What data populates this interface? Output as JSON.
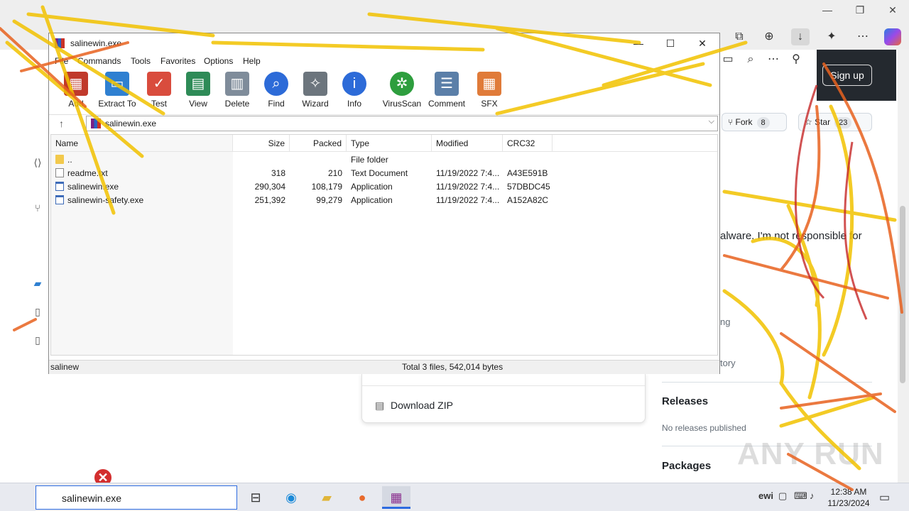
{
  "browser": {
    "signup_label": "Sign up",
    "fork_label": "Fork",
    "fork_count": "8",
    "star_label": "Star",
    "star_count": "23",
    "about_fragment": "alware. I'm not responsible for",
    "fragment_ng": "ng",
    "fragment_tory": "tory",
    "releases_heading": "Releases",
    "releases_text": "No releases published",
    "packages_heading": "Packages",
    "download_zip_label": "Download ZIP",
    "watermark": "ANY RUN"
  },
  "winrar": {
    "title": "salinewin.exe",
    "menu": [
      "File",
      "Commands",
      "Tools",
      "Favorites",
      "Options",
      "Help"
    ],
    "toolbar": [
      {
        "label": "Add",
        "icon": "add-icon",
        "color": "#c0392b"
      },
      {
        "label": "Extract To",
        "icon": "extract-icon",
        "color": "#2f80d1"
      },
      {
        "label": "Test",
        "icon": "test-icon",
        "color": "#d94c3d"
      },
      {
        "label": "View",
        "icon": "view-icon",
        "color": "#2e8b57"
      },
      {
        "label": "Delete",
        "icon": "delete-icon",
        "color": "#7f8c9a"
      },
      {
        "label": "Find",
        "icon": "find-icon",
        "color": "#2d6bd8"
      },
      {
        "label": "Wizard",
        "icon": "wizard-icon",
        "color": "#6c757d"
      },
      {
        "label": "Info",
        "icon": "info-icon",
        "color": "#2d6bd8"
      },
      {
        "label": "VirusScan",
        "icon": "virusscan-icon",
        "color": "#2e9e3e"
      },
      {
        "label": "Comment",
        "icon": "comment-icon",
        "color": "#5b7fa8"
      },
      {
        "label": "SFX",
        "icon": "sfx-icon",
        "color": "#e07b39"
      }
    ],
    "address": "salinewin.exe",
    "columns": [
      "Name",
      "Size",
      "Packed",
      "Type",
      "Modified",
      "CRC32"
    ],
    "rows": [
      {
        "icon": "folder",
        "name": "..",
        "size": "",
        "packed": "",
        "type": "File folder",
        "modified": "",
        "crc": ""
      },
      {
        "icon": "txt",
        "name": "readme.txt",
        "size": "318",
        "packed": "210",
        "type": "Text Document",
        "modified": "11/19/2022 7:4...",
        "crc": "A43E591B"
      },
      {
        "icon": "exe",
        "name": "salinewin.exe",
        "size": "290,304",
        "packed": "108,179",
        "type": "Application",
        "modified": "11/19/2022 7:4...",
        "crc": "57DBDC45"
      },
      {
        "icon": "exe",
        "name": "salinewin-safety.exe",
        "size": "251,392",
        "packed": "99,279",
        "type": "Application",
        "modified": "11/19/2022 7:4...",
        "crc": "A152A82C"
      }
    ],
    "status_left": "salinew",
    "status_right": "Total 3 files, 542,014 bytes"
  },
  "taskbar": {
    "search_text": "salinewin.exe",
    "tray_text": "ewi",
    "time": "12:38 AM",
    "date": "11/23/2024"
  }
}
